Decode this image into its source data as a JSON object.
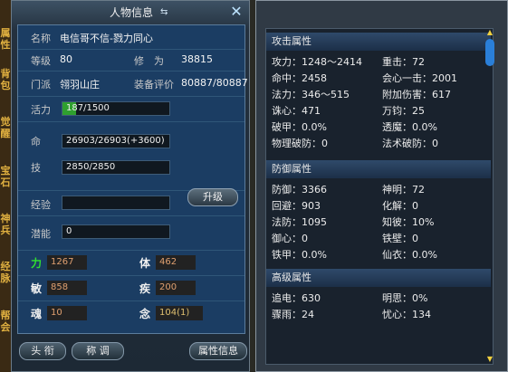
{
  "side_tabs": [
    "属性",
    "背包",
    "觉醒",
    "宝石",
    "神兵",
    "经脉",
    "帮会"
  ],
  "left": {
    "title": "人物信息",
    "name_label": "名称",
    "name_value": "电信哥不信-戮力同心",
    "level_label": "等级",
    "level_value": "80",
    "cultivation_label": "修　为",
    "cultivation_value": "38815",
    "faction_label": "门派",
    "faction_value": "翎羽山庄",
    "equip_label": "装备评价",
    "equip_value": "80887/80887",
    "vitality_label": "活力",
    "vitality_value": "187/1500",
    "vitality_fraction": 0.125,
    "hp_label": "命",
    "hp_value": "26903/26903(+3600)",
    "mp_label": "技",
    "mp_value": "2850/2850",
    "exp_label": "经验",
    "exp_value": "",
    "upgrade_label": "升级",
    "potential_label": "潜能",
    "potential_value": "0",
    "str_label": "力",
    "str_value": "1267",
    "phy_label": "体",
    "phy_value": "462",
    "agi_label": "敏",
    "agi_value": "858",
    "spd_label": "疾",
    "spd_value": "200",
    "soul_label": "魂",
    "soul_value": "10",
    "mind_label": "念",
    "mind_value": "104(1)",
    "btn_title": "头 衔",
    "btn_nick": "称 调",
    "btn_attr": "属性信息"
  },
  "right": {
    "attack_header": "攻击属性",
    "attack": [
      [
        "攻力：1248～2414",
        "重击：72"
      ],
      [
        "命中：2458",
        "会心一击：2001"
      ],
      [
        "法力：346～515",
        "附加伤害：617"
      ],
      [
        "诛心：471",
        "万钧：25"
      ],
      [
        "破甲：0.0%",
        "透魔：0.0%"
      ],
      [
        "物理破防：0",
        "法术破防：0"
      ]
    ],
    "defense_header": "防御属性",
    "defense": [
      [
        "防御：3366",
        "神明：72"
      ],
      [
        "回避：903",
        "化解：0"
      ],
      [
        "法防：1095",
        "知彼：10%"
      ],
      [
        "御心：0",
        "铁壁：0"
      ],
      [
        "铁甲：0.0%",
        "仙衣：0.0%"
      ]
    ],
    "advanced_header": "高级属性",
    "advanced": [
      [
        "追电：630",
        "明思：0%"
      ],
      [
        "骤雨：24",
        "忧心：134"
      ]
    ]
  }
}
